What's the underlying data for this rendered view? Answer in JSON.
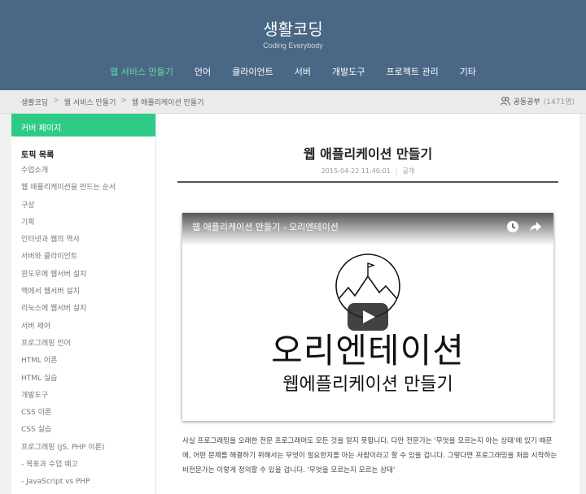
{
  "header": {
    "site_title": "생활코딩",
    "site_subtitle": "Coding Everybody",
    "nav": [
      "웹 서비스 만들기",
      "언어",
      "클라이언트",
      "서버",
      "개발도구",
      "프로젝트 관리",
      "기타"
    ]
  },
  "breadcrumb": {
    "items": [
      "생활코딩",
      "웹 서비스 만들기",
      "웹 애플리케이션 만들기"
    ],
    "separator": ">",
    "members_label": "공동공부",
    "members_count": "(1471명)"
  },
  "sidebar": {
    "cover_label": "커버 페이지",
    "toc_title": "토픽 목록",
    "items": [
      "수업소개",
      "웹 애플리케이션을 만드는 순서",
      "구상",
      "기획",
      "인터넷과 웹의 역사",
      "서버와 클라이언트",
      "윈도우에 웹서버 설치",
      "맥에서 웹서버 설치",
      "리눅스에 웹서버 설치",
      "서버 제어",
      "프로그래밍 언어",
      "HTML 이론",
      "HTML 실습",
      "개발도구",
      "CSS 이론",
      "CSS 실습",
      "프로그래밍 (JS, PHP 이론)",
      "- 목표과 수업 예고",
      "- JavaScript vs PHP"
    ]
  },
  "post": {
    "title": "웹 애플리케이션 만들기",
    "date": "2015-04-22 11:40:01",
    "visibility": "공개",
    "video": {
      "title": "웹 애플리케이션 만들기 - 오리엔테이션",
      "big_text": "오리엔테이션",
      "sub_text": "웹에플리케이션 만들기",
      "icons": [
        "clock-icon",
        "share-icon",
        "play-icon"
      ]
    },
    "body": "사실 프로그래밍을 오래한 전문 프로그래머도 모든 것을 알지 못합니다. 다만 전문가는 '무엇을 모르는지 아는 상태'에 있기 때문에, 어떤 문제를 해결하기 위해서는 무엇이 필요한지를 아는 사람이라고 할 수 있을 겁니다. 그렇다면 프로그래밍을 처음 시작하는 비전문가는 이렇게 정의할 수 있을 겁니다. '무엇을 모르는지 모르는 상태'"
  },
  "colors": {
    "header_bg": "#4a6786",
    "nav_active": "#5fe0a8",
    "cover_bg": "#2ecb87"
  }
}
